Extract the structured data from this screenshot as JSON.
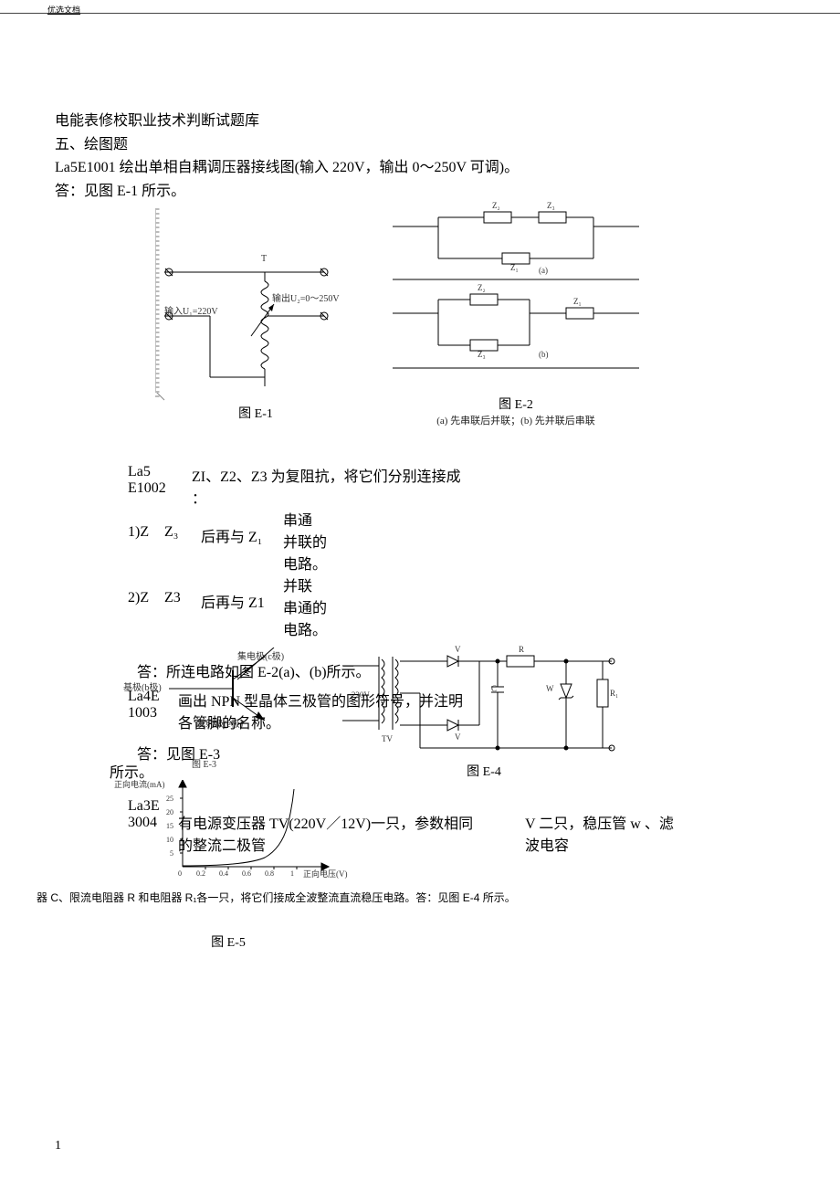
{
  "header_tag": "优选文档",
  "title_line": "电能表修校职业技术判断试题库",
  "section_line": "五、绘图题",
  "q1": "La5E1001 绘出单相自耦调压器接线图(输入 220V，输出 0～250V 可调)。",
  "a1": "答：见图 E-1 所示。",
  "fig_e1": {
    "caption": "图 E-1",
    "label_T": "T",
    "input_label": "输入U₁=220V",
    "output_label": "输出U₂=0～250V"
  },
  "fig_e2": {
    "caption": "图 E-2",
    "sub": "(a) 先串联后并联；(b) 先并联后串联",
    "z1": "Z₁",
    "z2": "Z₂",
    "z3": "Z₃",
    "a": "(a)",
    "b": "(b)"
  },
  "q2": {
    "left_a": "La5",
    "left_b": "E1002",
    "right_a": "ZI、Z2、Z3 为复阻抗，将它们分别连接成",
    "right_b": "：",
    "r1a": "1)Z",
    "r1b": "Z₃",
    "r1c": "后再与 Z₁",
    "r1d": "串通",
    "r1e": "并联的电路。",
    "r2a": "2)Z",
    "r2b": "Z3",
    "r2c": "后再与 Z1",
    "r2d": "并联",
    "r2e": "串通的电路。",
    "ans": "答：所连电路如图 E-2(a)、(b)所示。"
  },
  "q3": {
    "left_a": "La4E",
    "left_b": "1003",
    "right": "画出 NPN 型晶体三极管的图形符号，并注明各管脚的名称。",
    "ans_a": "答：见图 E-3",
    "ans_b": "所示。"
  },
  "fig_e3": {
    "caption": "图 E-3",
    "c": "集电极(c极)",
    "b": "基极(b极)",
    "e": "发射极(e极)"
  },
  "fig_e4": {
    "caption": "图 E-4",
    "v220": "~220V",
    "tv": "TV",
    "V": "V",
    "R": "R",
    "C": "C",
    "W": "W",
    "R1": "R₁"
  },
  "q4": {
    "left_a": "La3E",
    "left_b": "3004",
    "mid_a": "有电源变压器 TV(220V／12V)一只，参数相同",
    "mid_b": "的整流二极管",
    "right_a": "V 二只，稳压管 w 、滤",
    "right_b": "波电容",
    "tail": "器 C、限流电阻器 R 和电阻器 R₁各一只，将它们接成全波整流直流稳压电路。答：见图 E-4 所示。"
  },
  "fig_e5": {
    "caption": "图 E-5",
    "ylabel": "正向电流(mA)",
    "xlabel": "正向电压(V)",
    "yticks": [
      "5",
      "10",
      "15",
      "20",
      "25"
    ],
    "xticks": [
      "0",
      "0.2",
      "0.4",
      "0.6",
      "0.8",
      "1"
    ]
  },
  "page_num": "1"
}
